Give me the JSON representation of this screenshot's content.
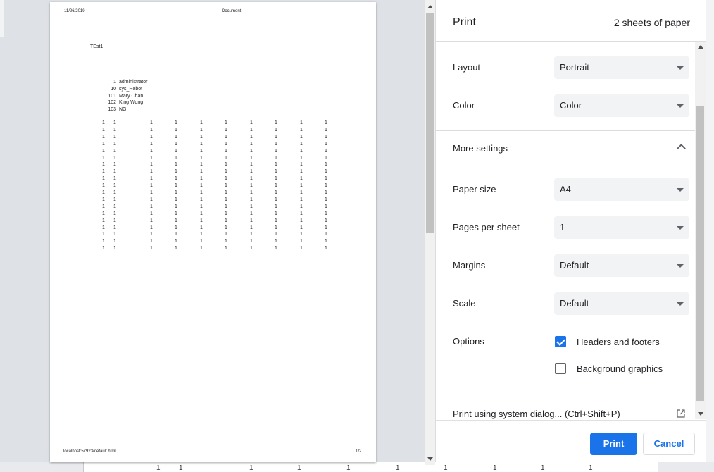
{
  "preview": {
    "header_date": "11/26/2019",
    "header_title": "Document",
    "doc_heading": "TEst1",
    "users": [
      {
        "id": "1",
        "name": "administrator"
      },
      {
        "id": "10",
        "name": "sys_Robot"
      },
      {
        "id": "101",
        "name": "Mary Chan"
      },
      {
        "id": "102",
        "name": "King Wong"
      },
      {
        "id": "103",
        "name": "NG"
      }
    ],
    "grid_value": "1",
    "grid_rows": 19,
    "footer_url": "localhost:57923/default.html",
    "footer_page": "1/2"
  },
  "panel": {
    "title": "Print",
    "sheets": "2 sheets of paper",
    "layout": {
      "label": "Layout",
      "value": "Portrait"
    },
    "color": {
      "label": "Color",
      "value": "Color"
    },
    "more_settings": "More settings",
    "paper_size": {
      "label": "Paper size",
      "value": "A4"
    },
    "pages_per_sheet": {
      "label": "Pages per sheet",
      "value": "1"
    },
    "margins": {
      "label": "Margins",
      "value": "Default"
    },
    "scale": {
      "label": "Scale",
      "value": "Default"
    },
    "options": {
      "label": "Options",
      "headers_footers": {
        "label": "Headers and footers",
        "checked": true
      },
      "background_graphics": {
        "label": "Background graphics",
        "checked": false
      }
    },
    "system_dialog": "Print using system dialog... (Ctrl+Shift+P)",
    "print_button": "Print",
    "cancel_button": "Cancel"
  },
  "colors": {
    "accent": "#1a73e8",
    "preview_bg": "#dee1e6"
  }
}
